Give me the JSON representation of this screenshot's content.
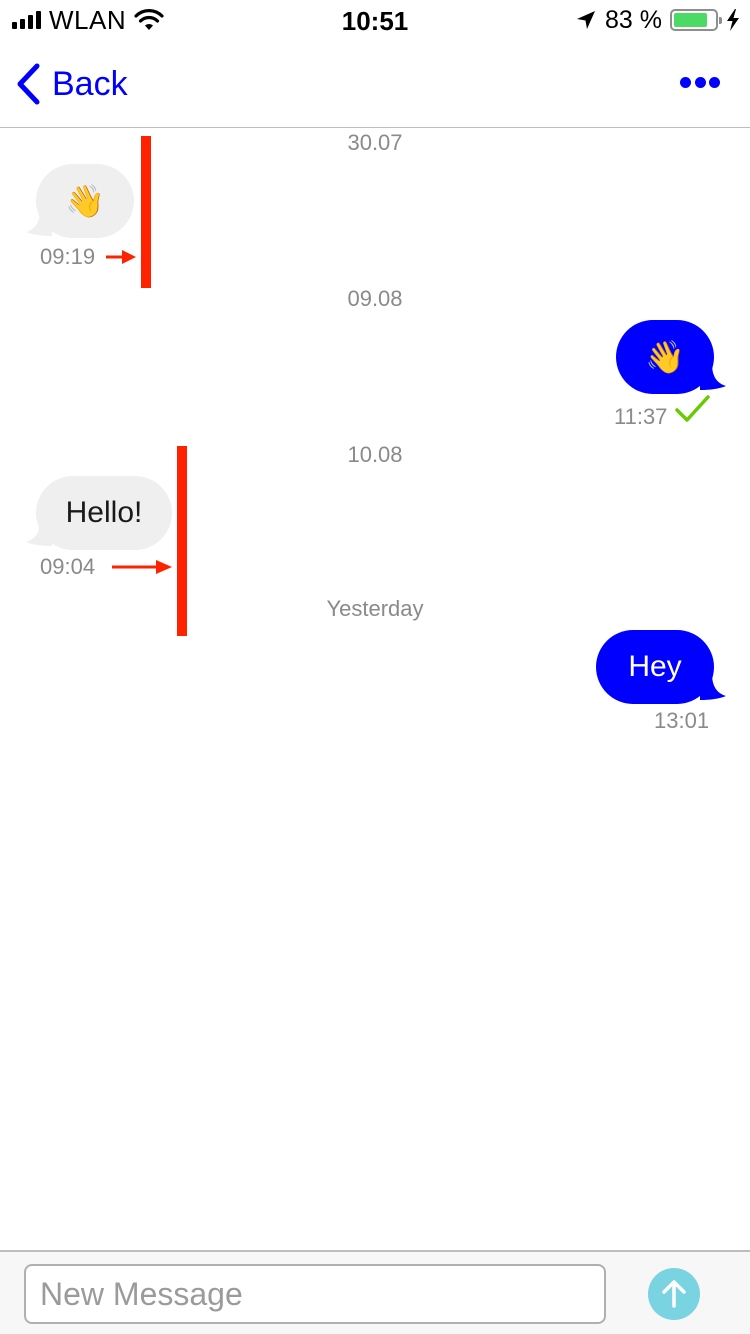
{
  "status_bar": {
    "carrier": "WLAN",
    "time": "10:51",
    "battery_percent": "83 %",
    "battery_level": 0.83,
    "icons": [
      "signal-icon",
      "wifi-icon",
      "location-arrow-icon",
      "battery-icon",
      "charging-bolt-icon"
    ]
  },
  "nav": {
    "back_label": "Back",
    "more_icon": "ellipsis-icon"
  },
  "thread": [
    {
      "date": "30.07"
    },
    {
      "direction": "incoming",
      "content": "👋",
      "time": "09:19"
    },
    {
      "date": "09.08"
    },
    {
      "direction": "outgoing",
      "content": "👋",
      "time": "11:37",
      "status": "delivered-check"
    },
    {
      "date": "10.08"
    },
    {
      "direction": "incoming",
      "content": "Hello!",
      "time": "09:04"
    },
    {
      "date": "Yesterday"
    },
    {
      "direction": "outgoing",
      "content": "Hey",
      "time": "13:01"
    }
  ],
  "composer": {
    "placeholder": "New Message",
    "value": "",
    "send_icon": "arrow-up-icon"
  },
  "colors": {
    "accent": "#0000ff",
    "incoming_bubble": "#efefef",
    "outgoing_bubble": "#0000ff",
    "delivered_check": "#66cc00",
    "annotation": "#ff2200",
    "send_button": "#7ad3e0",
    "battery_fill": "#4cd964"
  }
}
